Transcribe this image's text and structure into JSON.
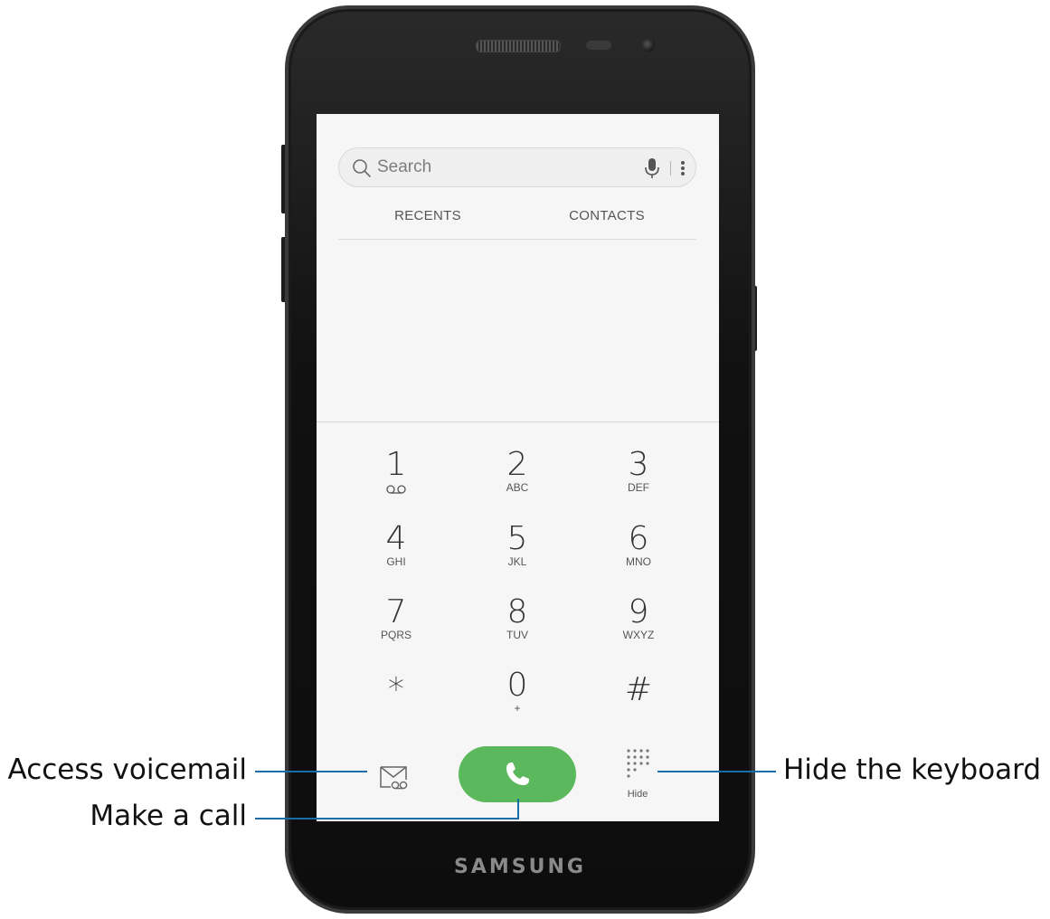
{
  "device": {
    "brand": "SAMSUNG"
  },
  "search": {
    "placeholder": "Search"
  },
  "tabs": [
    {
      "label": "RECENTS"
    },
    {
      "label": "CONTACTS"
    }
  ],
  "keypad": [
    {
      "digit": "1",
      "letters": "",
      "icon": "voicemail-icon"
    },
    {
      "digit": "2",
      "letters": "ABC"
    },
    {
      "digit": "3",
      "letters": "DEF"
    },
    {
      "digit": "4",
      "letters": "GHI"
    },
    {
      "digit": "5",
      "letters": "JKL"
    },
    {
      "digit": "6",
      "letters": "MNO"
    },
    {
      "digit": "7",
      "letters": "PQRS"
    },
    {
      "digit": "8",
      "letters": "TUV"
    },
    {
      "digit": "9",
      "letters": "WXYZ"
    },
    {
      "digit": "*",
      "letters": ""
    },
    {
      "digit": "0",
      "letters": "+"
    },
    {
      "digit": "#",
      "letters": ""
    }
  ],
  "actions": {
    "hide_label": "Hide",
    "call_color": "#5cb85c"
  },
  "callouts": {
    "voicemail": "Access voicemail",
    "call": "Make a call",
    "hide": "Hide the keyboard",
    "line_color": "#1a6ea8"
  }
}
